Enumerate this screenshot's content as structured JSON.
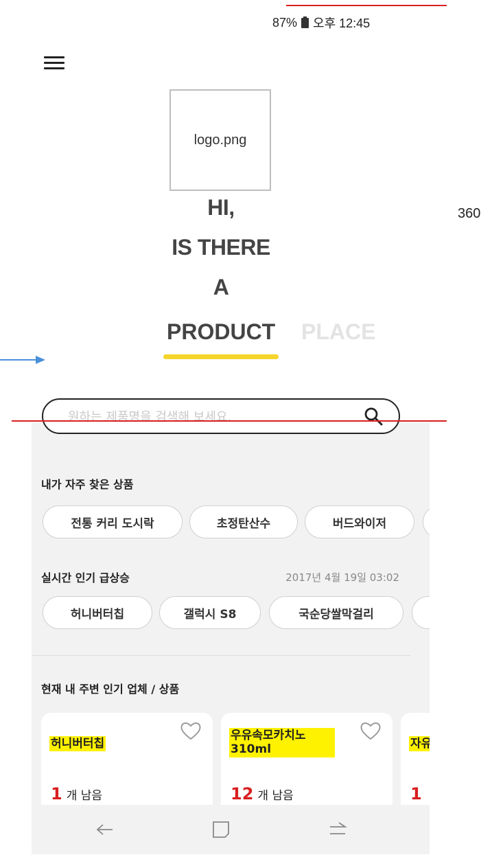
{
  "status_bar": {
    "battery": "87%",
    "time": "오후 12:45"
  },
  "logo": {
    "text": "logo.png"
  },
  "headline": {
    "line1": "HI,",
    "line2": "IS THERE",
    "line3": "A"
  },
  "tabs": {
    "product": "PRODUCT",
    "place": "PLACE"
  },
  "side_annotation": "360",
  "search": {
    "placeholder": "원하는 제품명을 검색해 보세요."
  },
  "frequent": {
    "title": "내가 자주 찾은 상품",
    "chips": [
      "전통 커리 도시락",
      "초정탄산수",
      "버드와이저"
    ]
  },
  "trending": {
    "title": "실시간 인기 급상승",
    "timestamp": "2017년 4월 19일 03:02",
    "chips": [
      "허니버터칩",
      "갤럭시 S8",
      "국순당쌀막걸리"
    ]
  },
  "nearby": {
    "title": "현재 내 주변 인기 업체 / 상품",
    "cards": [
      {
        "title": "허니버터칩",
        "count": "1",
        "unit": "개 남음"
      },
      {
        "title": "우유속모카치노 310ml",
        "count": "12",
        "unit": "개 남음"
      },
      {
        "title": "자유",
        "count": "1",
        "unit": ""
      }
    ]
  },
  "colors": {
    "accent_yellow": "#f5d52b",
    "highlight": "#fff200",
    "count_red": "#d81f1f",
    "guide_red": "#d81f1f",
    "arrow_blue": "#4a90d9"
  },
  "icons": [
    "battery-icon",
    "hamburger-icon",
    "search-icon",
    "heart-icon",
    "back-icon",
    "home-icon",
    "recents-icon",
    "arrow-icon"
  ]
}
